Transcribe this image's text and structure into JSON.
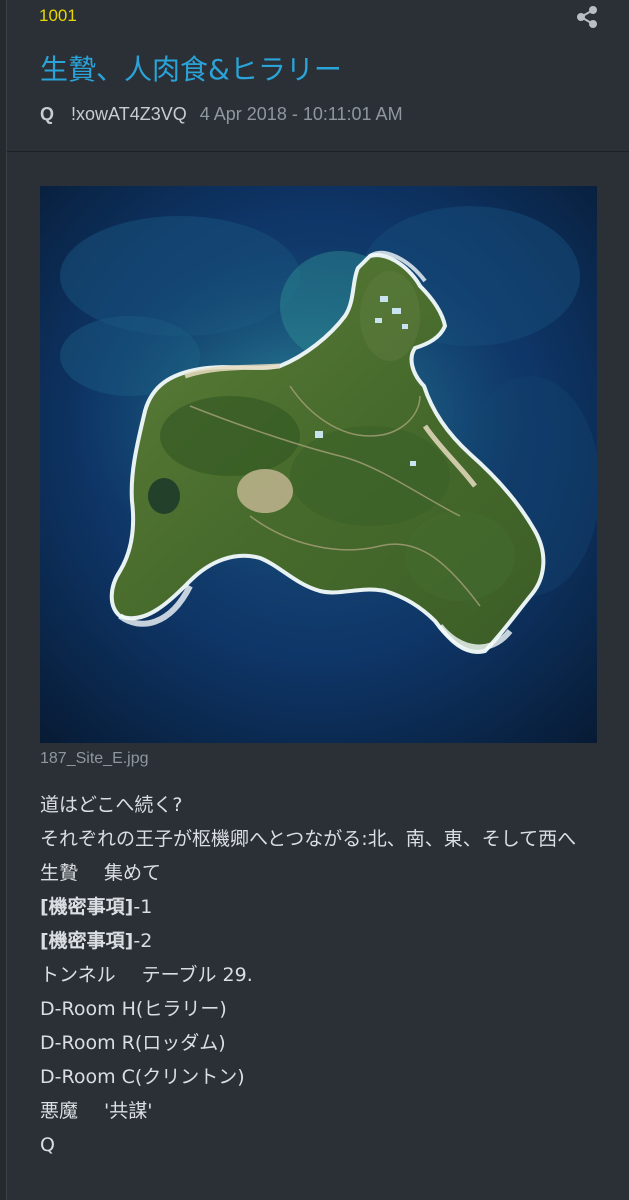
{
  "post": {
    "number": "1001",
    "title": "生贄、人肉食&ヒラリー",
    "author": "Q",
    "tripcode": "!xowAT4Z3VQ",
    "timestamp": "4 Apr 2018 - 10:11:01 AM",
    "share_icon": "share-icon",
    "attachment": {
      "filename": "187_Site_E.jpg",
      "description_icon": "aerial-island-photo"
    },
    "body": {
      "line1": "道はどこへ続く?",
      "line2": "それぞれの王子が枢機卿へとつながる:北、南、東、そして西へ",
      "line3a": "生贄",
      "line3b": "集めて",
      "line4a": "[機密事項]",
      "line4b": "-1",
      "line5a": "[機密事項]",
      "line5b": "-2",
      "line6a": "トンネル",
      "line6b": "テーブル 29.",
      "line7": "D-Room H(ヒラリー)",
      "line8": "D-Room R(ロッダム)",
      "line9": "D-Room C(クリントン)",
      "line10a": "悪魔",
      "line10b": "'共謀'",
      "line11": "Q"
    }
  },
  "colors": {
    "background": "#2b3036",
    "post_number": "#e8d600",
    "title": "#2aa3d8",
    "timestamp": "#8f979e"
  }
}
